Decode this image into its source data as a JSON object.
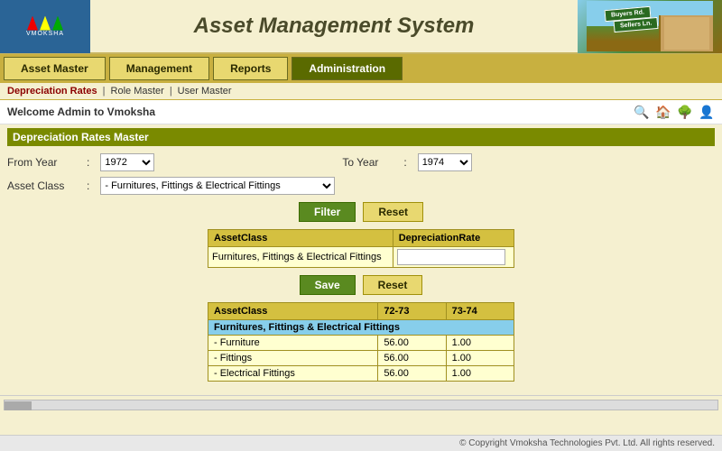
{
  "app": {
    "title": "Asset Management System",
    "logo": "VMOKSHA"
  },
  "nav": {
    "buttons": [
      {
        "label": "Asset Master",
        "style": "light"
      },
      {
        "label": "Management",
        "style": "light"
      },
      {
        "label": "Reports",
        "style": "light"
      },
      {
        "label": "Administration",
        "style": "dark"
      }
    ]
  },
  "breadcrumb": {
    "items": [
      {
        "label": "Depreciation Rates",
        "active": true
      },
      {
        "label": "Role Master",
        "active": false
      },
      {
        "label": "User Master",
        "active": false
      }
    ]
  },
  "welcome": {
    "text": "Welcome Admin to Vmoksha"
  },
  "section": {
    "title": "Depreciation Rates Master"
  },
  "form": {
    "from_year_label": "From Year",
    "from_year_value": "1972",
    "to_year_label": "To Year",
    "to_year_value": "1974",
    "asset_class_label": "Asset Class",
    "asset_class_value": "-  Furnitures, Fittings & Electrical Fittings",
    "filter_btn": "Filter",
    "reset_btn": "Reset",
    "save_btn": "Save",
    "reset_btn2": "Reset"
  },
  "edit_table": {
    "headers": [
      "AssetClass",
      "DepreciationRate"
    ],
    "row": {
      "asset_class": "Furnitures, Fittings & Electrical Fittings",
      "rate_value": ""
    }
  },
  "data_table": {
    "headers": [
      "AssetClass",
      "72-73",
      "73-74"
    ],
    "group": {
      "name": "Furnitures, Fittings & Electrical Fittings",
      "col2": "",
      "col3": ""
    },
    "rows": [
      {
        "name": "-  Furniture",
        "col2": "56.00",
        "col3": "1.00"
      },
      {
        "name": "-  Fittings",
        "col2": "56.00",
        "col3": "1.00"
      },
      {
        "name": "-  Electrical Fittings",
        "col2": "56.00",
        "col3": "1.00"
      }
    ]
  },
  "footer": {
    "text": "© Copyright Vmoksha Technologies Pvt. Ltd. All rights reserved."
  },
  "icons": {
    "search": "🔍",
    "home": "🏠",
    "tree": "🌳",
    "user": "👤"
  }
}
